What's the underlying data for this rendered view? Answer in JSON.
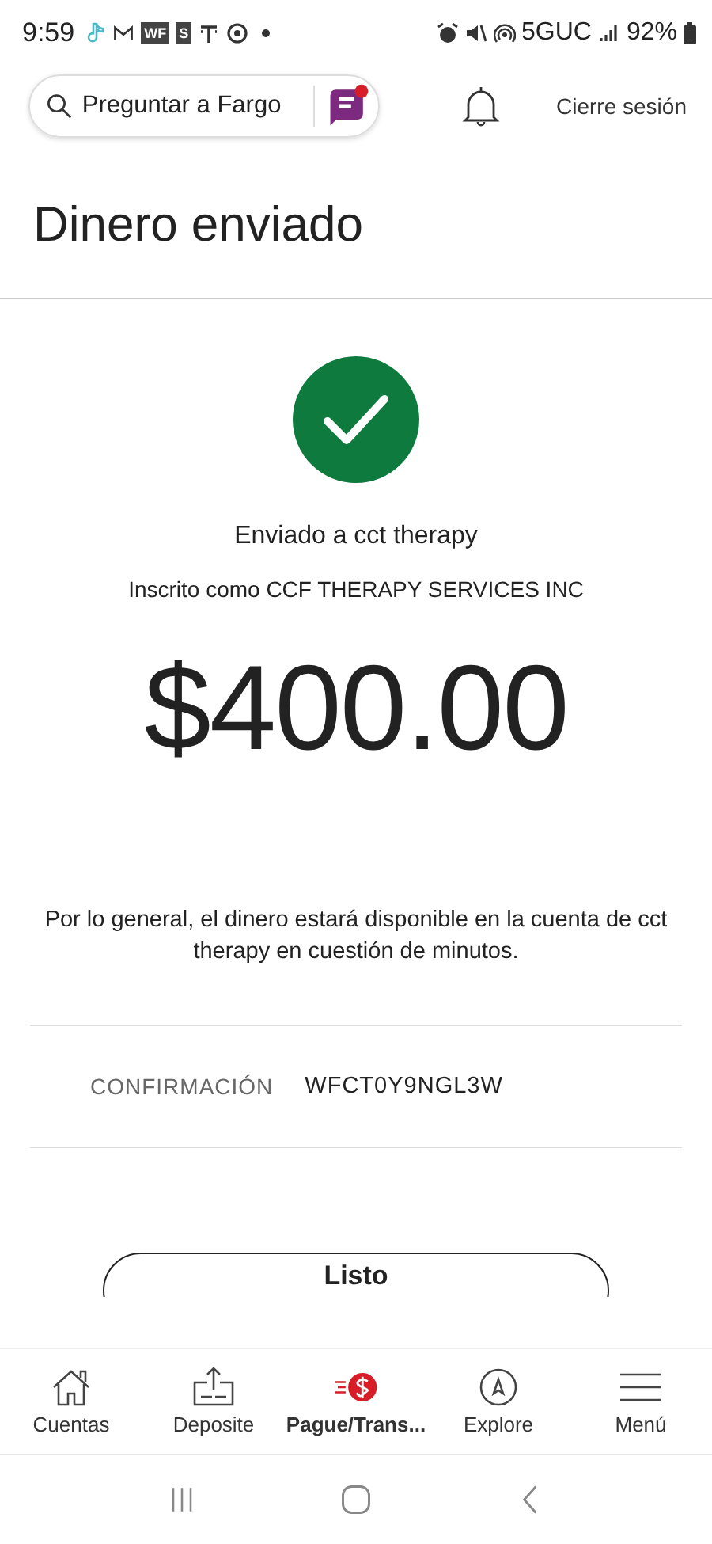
{
  "status_bar": {
    "time": "9:59",
    "badges": [
      "WF",
      "S"
    ],
    "network": "5GUC",
    "battery": "92%"
  },
  "header": {
    "search": {
      "placeholder": "Preguntar a Fargo"
    },
    "notification_dot": true,
    "logout": "Cierre sesión"
  },
  "title": "Dinero enviado",
  "confirmation": {
    "sent_to": "Enviado a cct therapy",
    "enrolled_as": "Inscrito como CCF THERAPY SERVICES INC",
    "amount": "$400.00",
    "note": "Por lo general, el dinero estará disponible en la cuenta de cct therapy en cuestión de minutos.",
    "label": "CONFIRMACIÓN",
    "code": "WFCT0Y9NGL3W"
  },
  "done_button": "Listo",
  "bottom_nav": [
    {
      "label": "Cuentas",
      "selected": false
    },
    {
      "label": "Deposite",
      "selected": false
    },
    {
      "label": "Pague/Trans...",
      "selected": true
    },
    {
      "label": "Explore",
      "selected": false
    },
    {
      "label": "Menú",
      "selected": false
    }
  ]
}
